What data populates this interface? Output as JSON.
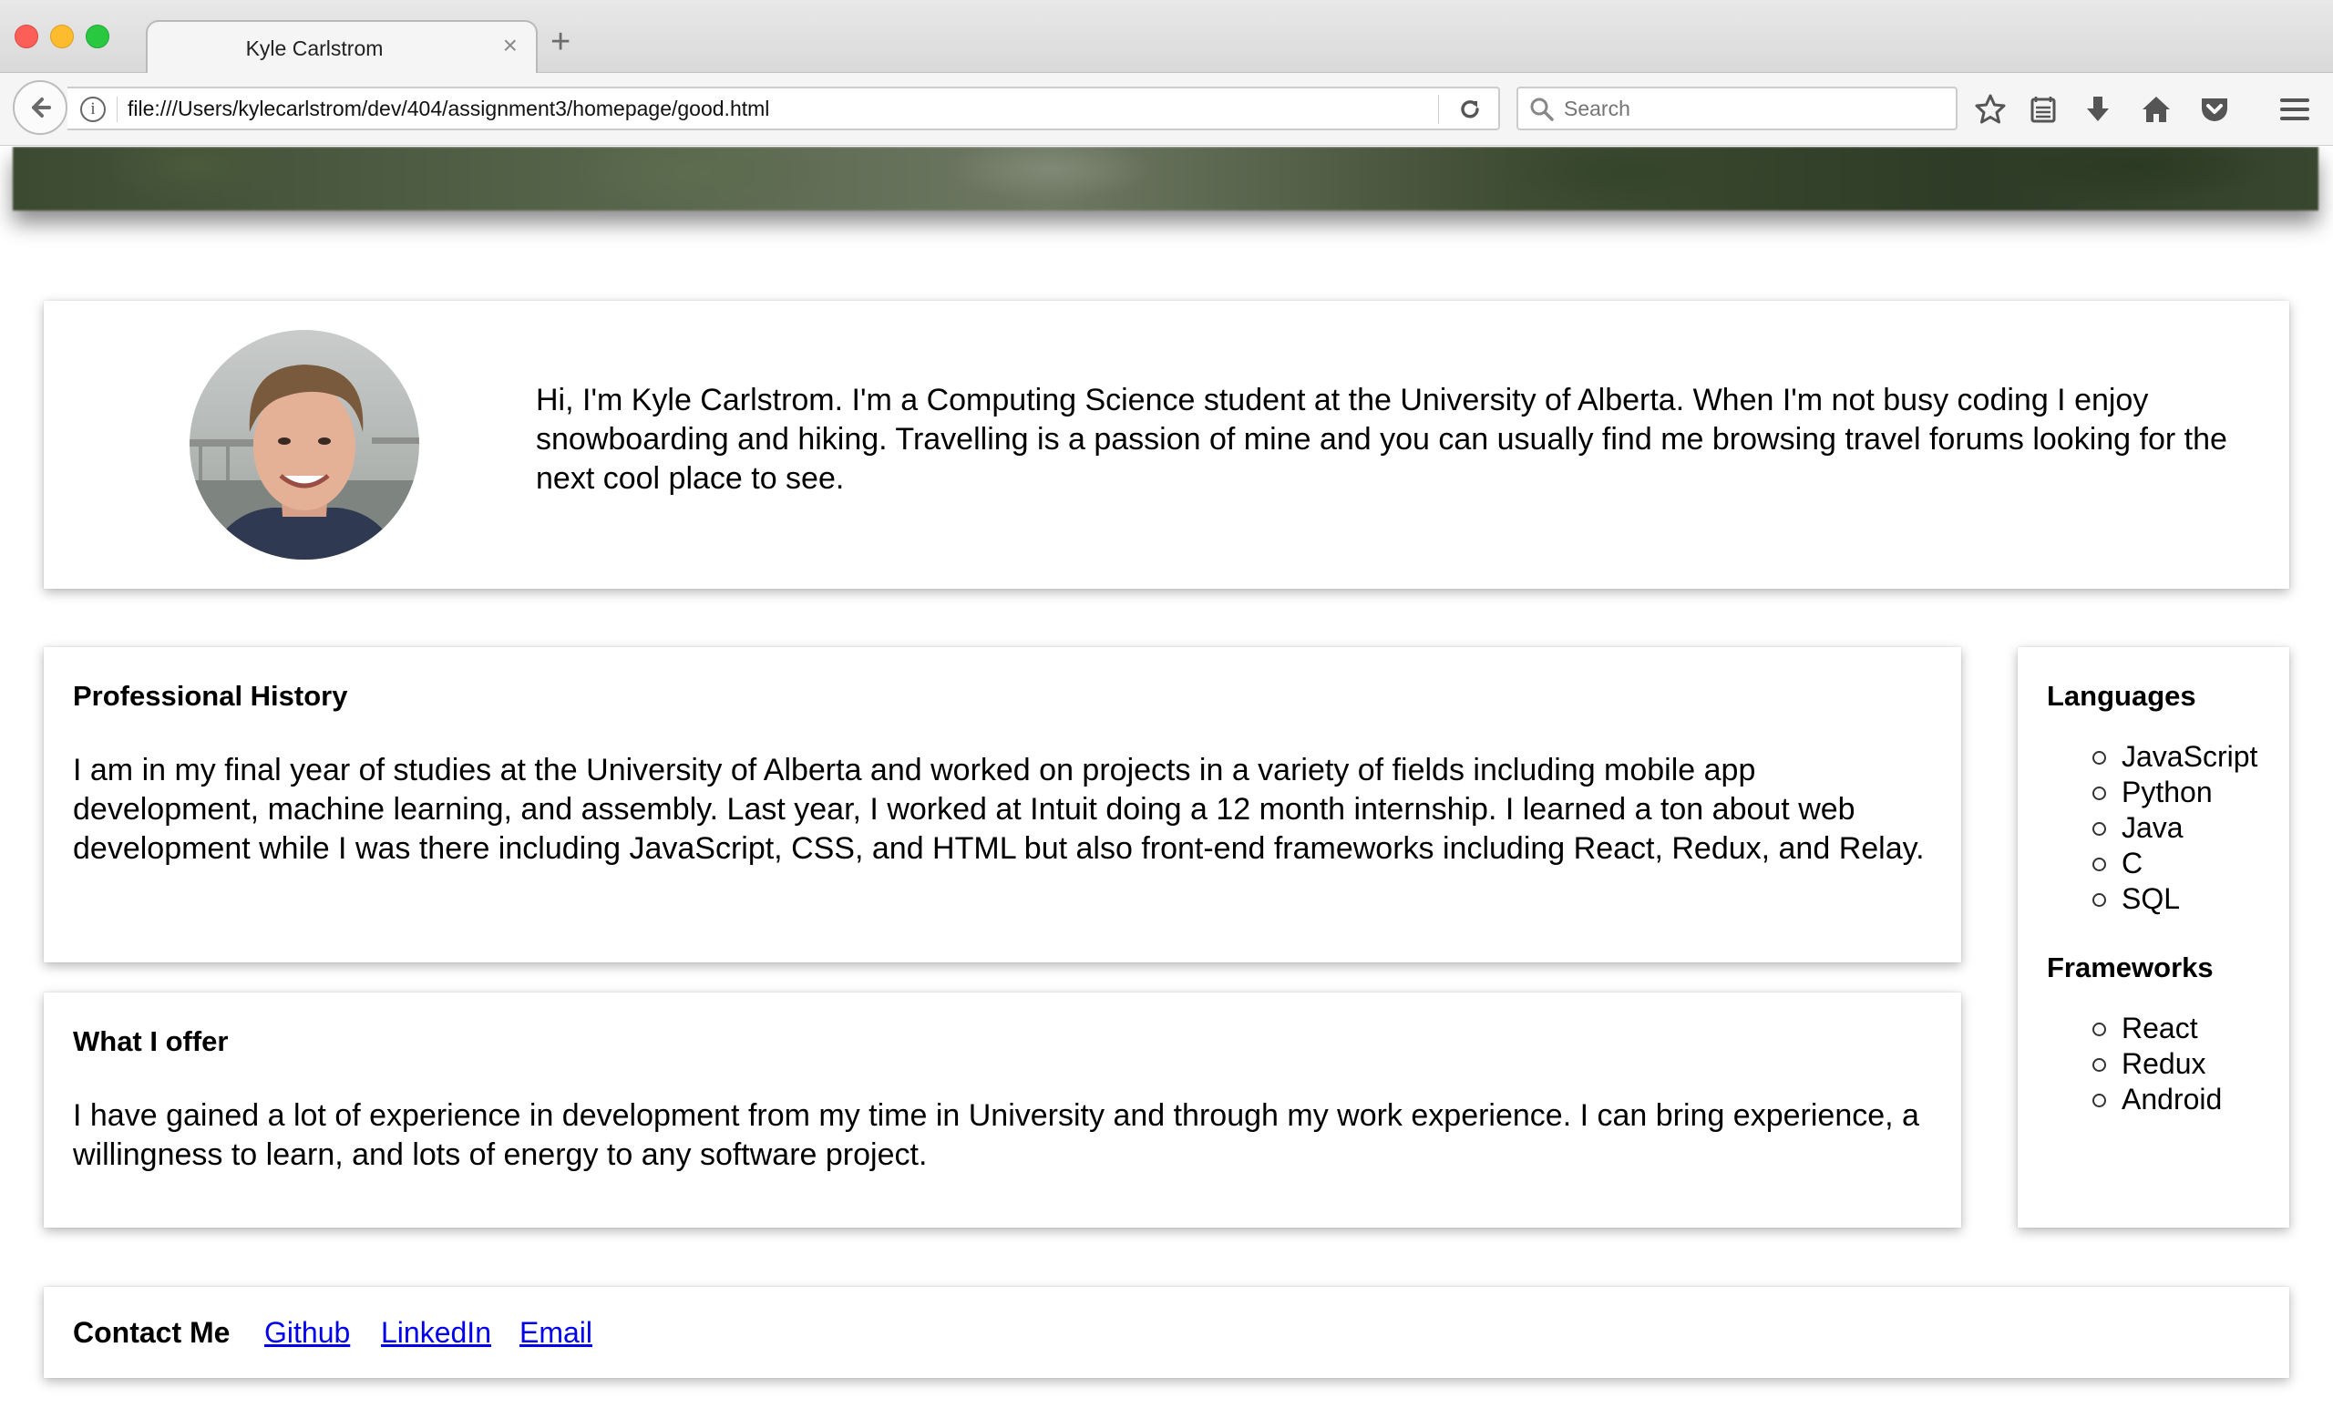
{
  "browser": {
    "tab_title": "Kyle Carlstrom",
    "tab_close": "×",
    "new_tab": "+",
    "url": "file:///Users/kylecarlstrom/dev/404/assignment3/homepage/good.html",
    "search_placeholder": "Search",
    "icons": [
      "back-arrow-icon",
      "info-icon",
      "reload-icon",
      "search-icon",
      "bookmark-star-icon",
      "reading-list-icon",
      "download-icon",
      "home-icon",
      "pocket-icon",
      "hamburger-menu-icon"
    ]
  },
  "intro": {
    "text": "Hi, I'm Kyle Carlstrom. I'm a Computing Science student at the University of Alberta. When I'm not busy coding I enjoy snowboarding and hiking. Travelling is a passion of mine and you can usually find me browsing travel forums looking for the next cool place to see."
  },
  "history": {
    "title": "Professional History",
    "body": "I am in my final year of studies at the University of Alberta and worked on projects in a variety of fields including mobile app development, machine learning, and assembly. Last year, I worked at Intuit doing a 12 month internship. I learned a ton about web development while I was there including JavaScript, CSS, and HTML but also front-end frameworks including React, Redux, and Relay."
  },
  "offer": {
    "title": "What I offer",
    "body": "I have gained a lot of experience in development from my time in University and through my work experience. I can bring experience, a willingness to learn, and lots of energy to any software project."
  },
  "skills": {
    "languages_title": "Languages",
    "languages": [
      "JavaScript",
      "Python",
      "Java",
      "C",
      "SQL"
    ],
    "frameworks_title": "Frameworks",
    "frameworks": [
      "React",
      "Redux",
      "Android"
    ]
  },
  "contact": {
    "title": "Contact Me",
    "links": [
      "Github",
      "LinkedIn",
      "Email"
    ]
  },
  "colors": {
    "link": "#0000ee",
    "traffic_red": "#fc5f57",
    "traffic_yellow": "#fdbc2e",
    "traffic_green": "#29c840"
  }
}
